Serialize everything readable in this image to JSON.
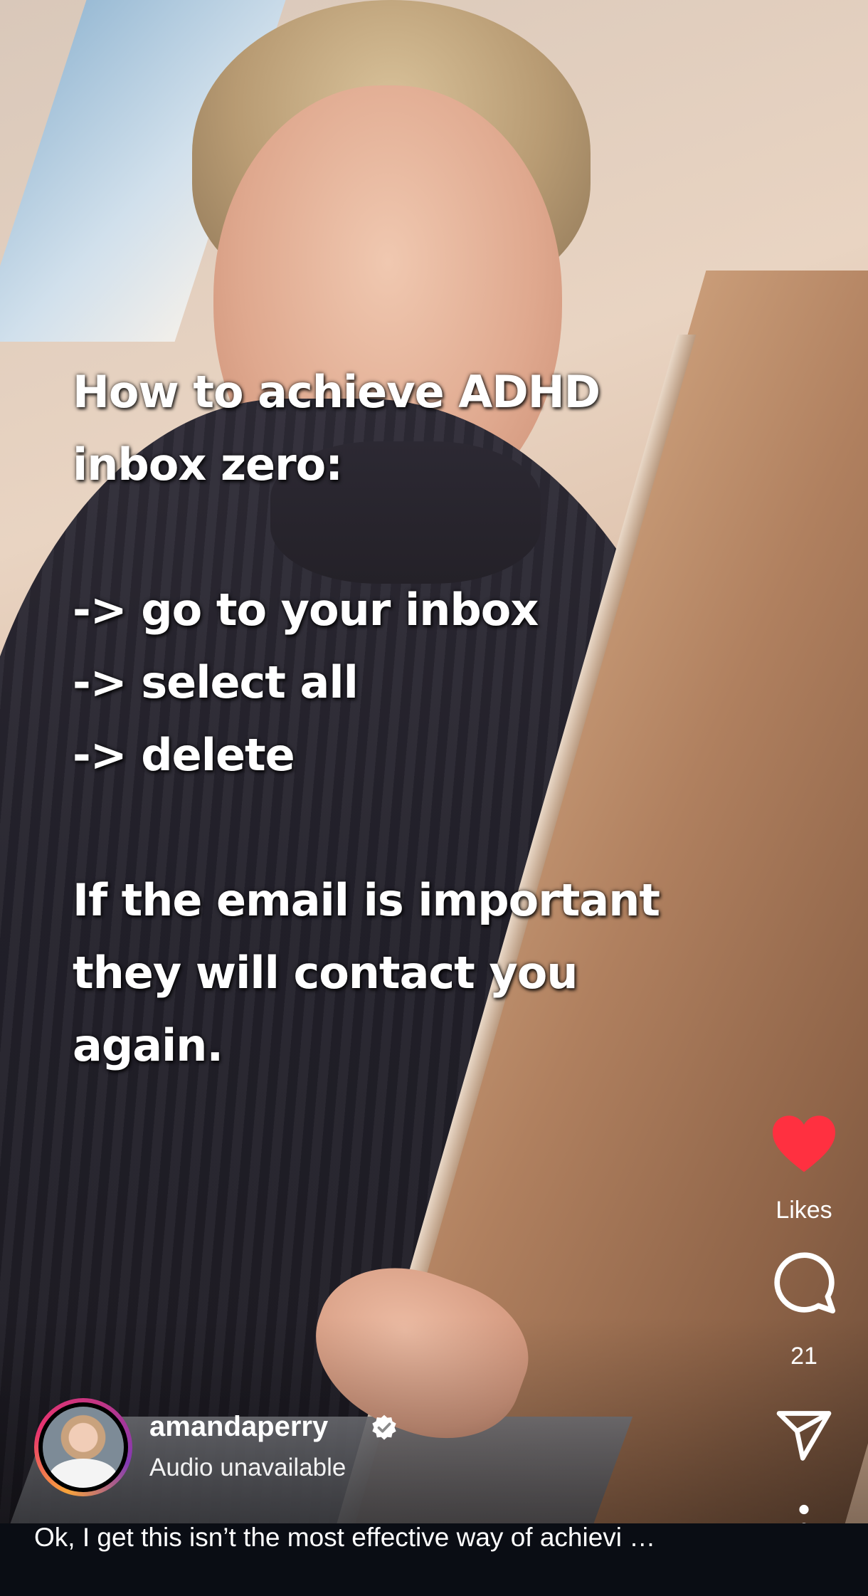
{
  "overlay": {
    "line1": "How to achieve ADHD",
    "line2": "inbox zero:",
    "line3": "-> go to your inbox",
    "line4": "-> select all",
    "line5": "-> delete",
    "line6": "If the email is important",
    "line7": "they will contact you",
    "line8": "again."
  },
  "rail": {
    "like_icon": "heart-filled-icon",
    "like_color": "#ff3040",
    "likes_label": "Likes",
    "comment_icon": "comment-bubble-icon",
    "comments_count": "21",
    "share_icon": "send-icon",
    "more_icon": "more-vertical-icon"
  },
  "author": {
    "username": "amandaperry",
    "verified_icon": "verified-badge-icon",
    "audio": "Audio unavailable"
  },
  "caption": {
    "text": "Ok, I get this isn’t the most effective way of achievi …"
  }
}
